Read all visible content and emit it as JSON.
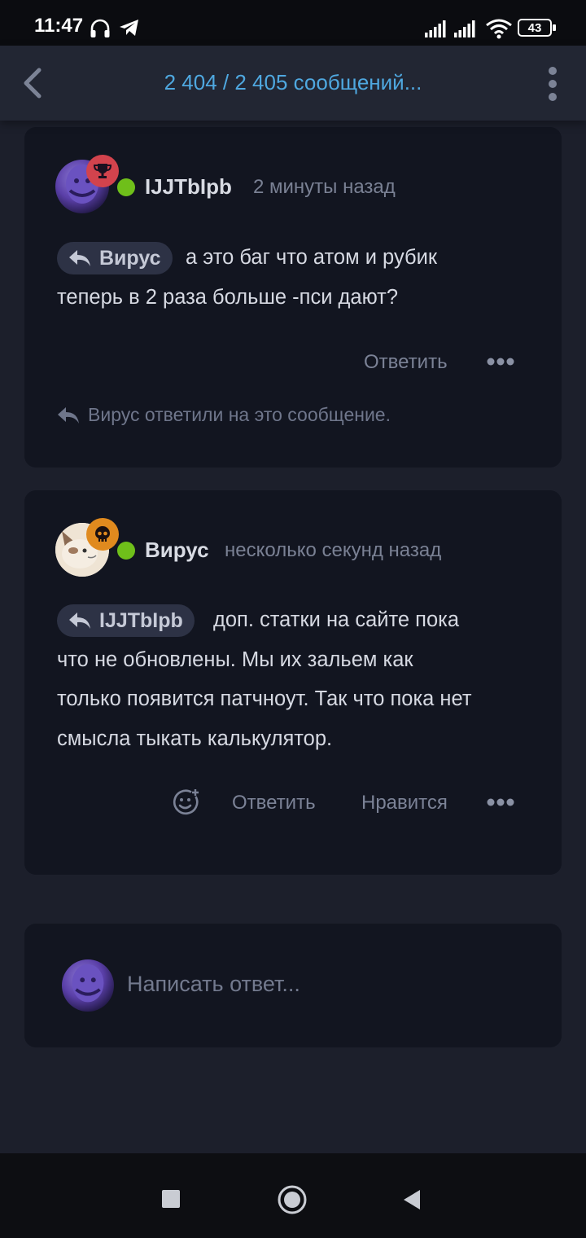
{
  "status_bar": {
    "time": "11:47",
    "battery": "43",
    "icons": [
      "headphones-icon",
      "telegram-icon",
      "signal-icon",
      "signal-icon",
      "wifi-icon",
      "battery-icon"
    ]
  },
  "header": {
    "title": "2 404 / 2 405 сообщений...",
    "back_icon": "chevron-left-icon",
    "menu_icon": "kebab-menu-icon"
  },
  "posts": [
    {
      "author": "IJJTbIpb",
      "time": "2 минуты назад",
      "badge_icon": "trophy-icon",
      "badge_color": "#d2434d",
      "online": true,
      "quote_author": "Вирус",
      "text_line1": "а это баг что атом и рубик",
      "text_line2": "теперь в 2 раза больше -пси дают?",
      "reply_label": "Ответить",
      "more_icon": "more-dots-icon",
      "replied_note": "Вирус ответили на это сообщение."
    },
    {
      "author": "Вирус",
      "time": "несколько секунд назад",
      "badge_icon": "skull-icon",
      "badge_color": "#e08a1e",
      "online": true,
      "quote_author": "IJJTbIpb",
      "text_line1": "доп. статки на сайте пока",
      "text_line2": "что не обновлены. Мы их зальем как",
      "text_line3": "только появится патчноут. Так что пока нет",
      "text_line4": "смысла тыкать калькулятор.",
      "react_icon": "add-reaction-icon",
      "reply_label": "Ответить",
      "like_label": "Нравится",
      "more_icon": "more-dots-icon"
    }
  ],
  "composer": {
    "placeholder": "Написать ответ..."
  },
  "nav_bar": {
    "recents_icon": "square-recents-icon",
    "home_icon": "circle-home-icon",
    "back_icon": "triangle-back-icon"
  }
}
